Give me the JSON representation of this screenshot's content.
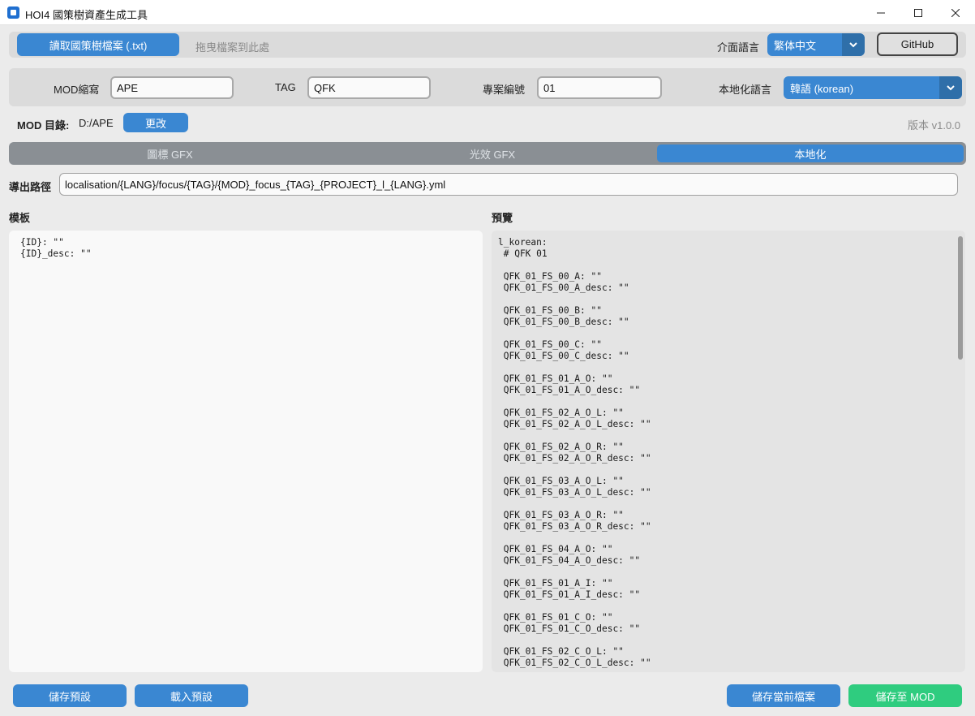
{
  "window": {
    "title": "HOI4 國策樹資產生成工具",
    "minimize_icon": "minimize-icon",
    "maximize_icon": "maximize-icon",
    "close_icon": "close-icon"
  },
  "topbar": {
    "open_file_label": "讀取國策樹檔案 (.txt)",
    "drop_hint": "拖曳檔案到此處",
    "ui_language_label": "介面語言",
    "ui_language_value": "繁体中文",
    "github_label": "GitHub"
  },
  "settings": {
    "mod_abbr_label": "MOD縮寫",
    "mod_abbr_value": "APE",
    "tag_label": "TAG",
    "tag_value": "QFK",
    "project_no_label": "專案編號",
    "project_no_value": "01",
    "loc_language_label": "本地化語言",
    "loc_language_value": "韓語 (korean)"
  },
  "mod_dir": {
    "label": "MOD 目錄:",
    "value": "D:/APE",
    "change_label": "更改",
    "version": "版本 v1.0.0"
  },
  "tabs": [
    {
      "label": "圖標 GFX",
      "active": false
    },
    {
      "label": "光效 GFX",
      "active": false
    },
    {
      "label": "本地化",
      "active": true
    }
  ],
  "export": {
    "label": "導出路徑",
    "value": "localisation/{LANG}/focus/{TAG}/{MOD}_focus_{TAG}_{PROJECT}_l_{LANG}.yml"
  },
  "template": {
    "title": "模板",
    "content": "{ID}: \"\"\n{ID}_desc: \"\""
  },
  "preview": {
    "title": "預覽",
    "content": "l_korean:\n # QFK 01\n\n QFK_01_FS_00_A: \"\"\n QFK_01_FS_00_A_desc: \"\"\n\n QFK_01_FS_00_B: \"\"\n QFK_01_FS_00_B_desc: \"\"\n\n QFK_01_FS_00_C: \"\"\n QFK_01_FS_00_C_desc: \"\"\n\n QFK_01_FS_01_A_O: \"\"\n QFK_01_FS_01_A_O_desc: \"\"\n\n QFK_01_FS_02_A_O_L: \"\"\n QFK_01_FS_02_A_O_L_desc: \"\"\n\n QFK_01_FS_02_A_O_R: \"\"\n QFK_01_FS_02_A_O_R_desc: \"\"\n\n QFK_01_FS_03_A_O_L: \"\"\n QFK_01_FS_03_A_O_L_desc: \"\"\n\n QFK_01_FS_03_A_O_R: \"\"\n QFK_01_FS_03_A_O_R_desc: \"\"\n\n QFK_01_FS_04_A_O: \"\"\n QFK_01_FS_04_A_O_desc: \"\"\n\n QFK_01_FS_01_A_I: \"\"\n QFK_01_FS_01_A_I_desc: \"\"\n\n QFK_01_FS_01_C_O: \"\"\n QFK_01_FS_01_C_O_desc: \"\"\n\n QFK_01_FS_02_C_O_L: \"\"\n QFK_01_FS_02_C_O_L_desc: \"\""
  },
  "footer": {
    "save_preset": "儲存預設",
    "load_preset": "載入預設",
    "save_current": "儲存當前檔案",
    "save_to_mod": "儲存至 MOD"
  },
  "colors": {
    "accent": "#3a87d2",
    "success": "#2fcc7f"
  }
}
